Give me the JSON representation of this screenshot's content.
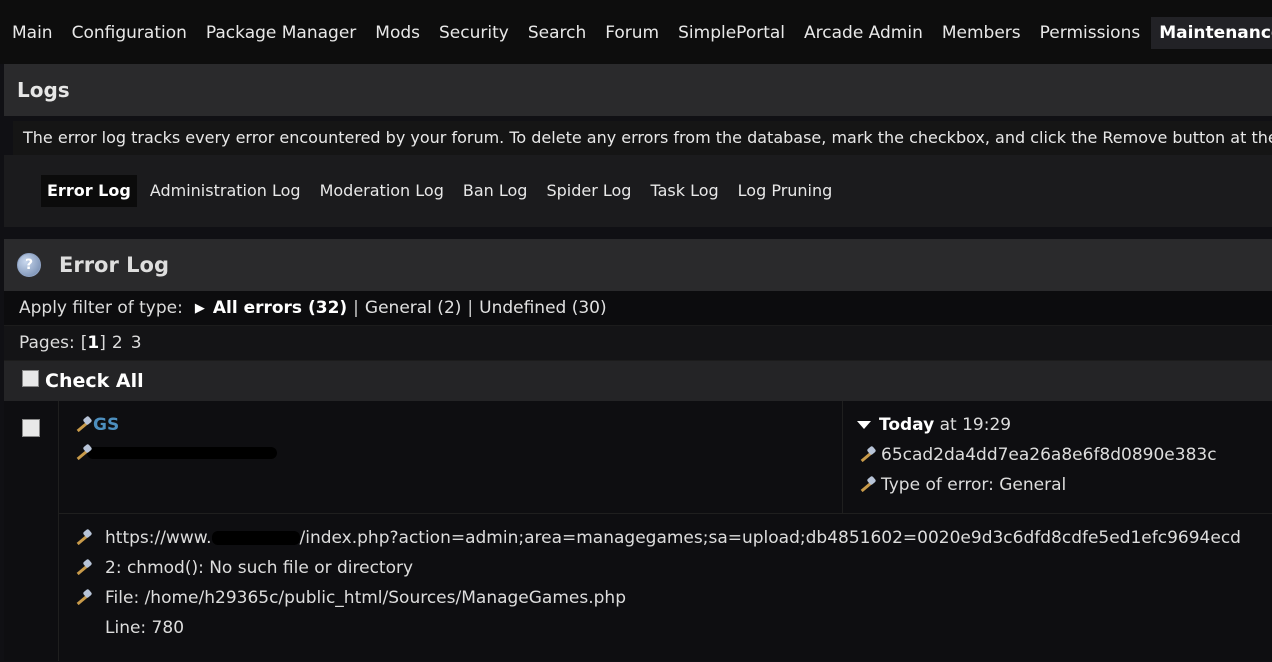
{
  "nav": {
    "items": [
      {
        "label": "Main"
      },
      {
        "label": "Configuration"
      },
      {
        "label": "Package Manager"
      },
      {
        "label": "Mods"
      },
      {
        "label": "Security"
      },
      {
        "label": "Search"
      },
      {
        "label": "Forum"
      },
      {
        "label": "SimplePortal"
      },
      {
        "label": "Arcade Admin"
      },
      {
        "label": "Members"
      },
      {
        "label": "Permissions"
      },
      {
        "label": "Maintenance"
      }
    ],
    "active": "Maintenance"
  },
  "logs": {
    "title": "Logs",
    "description": "The error log tracks every error encountered by your forum. To delete any errors from the database, mark the checkbox, and click the Remove button at the bottom of",
    "tabs": [
      {
        "label": "Error Log"
      },
      {
        "label": "Administration Log"
      },
      {
        "label": "Moderation Log"
      },
      {
        "label": "Ban Log"
      },
      {
        "label": "Spider Log"
      },
      {
        "label": "Task Log"
      },
      {
        "label": "Log Pruning"
      }
    ],
    "active_tab": "Error Log"
  },
  "error_log": {
    "title": "Error Log",
    "filter_label": "Apply filter of type:",
    "filters": [
      {
        "label": "All errors (32)"
      },
      {
        "label": "General (2)"
      },
      {
        "label": "Undefined (30)"
      }
    ],
    "pages_label": "Pages:",
    "pages": {
      "current": "1",
      "others": [
        "2",
        "3"
      ]
    },
    "check_all_label": "Check All",
    "entry": {
      "member": "GS",
      "date_bold": "Today",
      "date_rest": " at 19:29",
      "session": "65cad2da4dd7ea26a8e6f8d0890e383c",
      "type_of_error": "Type of error: General",
      "url_prefix": "https://www.",
      "url_suffix": "/index.php?action=admin;area=managegames;sa=upload;db4851602=0020e9d3c6dfd8cdfe5ed1efc9694ecd",
      "message": "2: chmod(): No such file or directory",
      "file": "File: /home/h29365c/public_html/Sources/ManageGames.php",
      "line": "Line: 780"
    }
  },
  "colors": {
    "member_link": "#4d8fbf",
    "header_bg": "#2a2a2c",
    "page_bg": "#101014"
  },
  "icons": {
    "help": "help-icon",
    "tool": "wrench-icon",
    "filter_arrow": "triangle-right-icon",
    "date_arrow": "triangle-down-icon"
  }
}
